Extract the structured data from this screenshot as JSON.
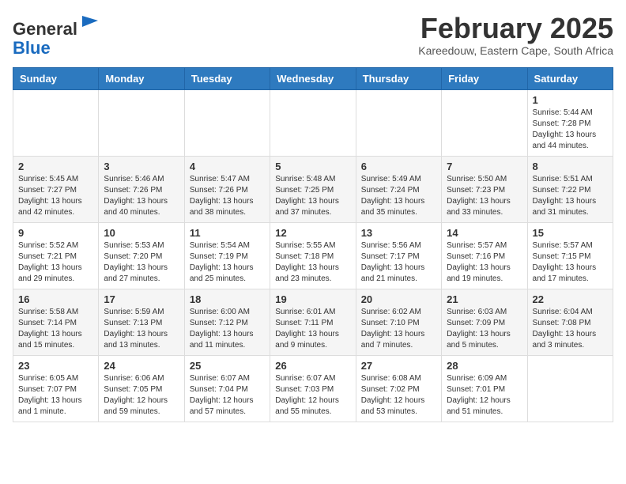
{
  "header": {
    "logo_general": "General",
    "logo_blue": "Blue",
    "month_title": "February 2025",
    "location": "Kareedouw, Eastern Cape, South Africa"
  },
  "weekdays": [
    "Sunday",
    "Monday",
    "Tuesday",
    "Wednesday",
    "Thursday",
    "Friday",
    "Saturday"
  ],
  "weeks": [
    [
      {
        "day": "",
        "info": ""
      },
      {
        "day": "",
        "info": ""
      },
      {
        "day": "",
        "info": ""
      },
      {
        "day": "",
        "info": ""
      },
      {
        "day": "",
        "info": ""
      },
      {
        "day": "",
        "info": ""
      },
      {
        "day": "1",
        "info": "Sunrise: 5:44 AM\nSunset: 7:28 PM\nDaylight: 13 hours\nand 44 minutes."
      }
    ],
    [
      {
        "day": "2",
        "info": "Sunrise: 5:45 AM\nSunset: 7:27 PM\nDaylight: 13 hours\nand 42 minutes."
      },
      {
        "day": "3",
        "info": "Sunrise: 5:46 AM\nSunset: 7:26 PM\nDaylight: 13 hours\nand 40 minutes."
      },
      {
        "day": "4",
        "info": "Sunrise: 5:47 AM\nSunset: 7:26 PM\nDaylight: 13 hours\nand 38 minutes."
      },
      {
        "day": "5",
        "info": "Sunrise: 5:48 AM\nSunset: 7:25 PM\nDaylight: 13 hours\nand 37 minutes."
      },
      {
        "day": "6",
        "info": "Sunrise: 5:49 AM\nSunset: 7:24 PM\nDaylight: 13 hours\nand 35 minutes."
      },
      {
        "day": "7",
        "info": "Sunrise: 5:50 AM\nSunset: 7:23 PM\nDaylight: 13 hours\nand 33 minutes."
      },
      {
        "day": "8",
        "info": "Sunrise: 5:51 AM\nSunset: 7:22 PM\nDaylight: 13 hours\nand 31 minutes."
      }
    ],
    [
      {
        "day": "9",
        "info": "Sunrise: 5:52 AM\nSunset: 7:21 PM\nDaylight: 13 hours\nand 29 minutes."
      },
      {
        "day": "10",
        "info": "Sunrise: 5:53 AM\nSunset: 7:20 PM\nDaylight: 13 hours\nand 27 minutes."
      },
      {
        "day": "11",
        "info": "Sunrise: 5:54 AM\nSunset: 7:19 PM\nDaylight: 13 hours\nand 25 minutes."
      },
      {
        "day": "12",
        "info": "Sunrise: 5:55 AM\nSunset: 7:18 PM\nDaylight: 13 hours\nand 23 minutes."
      },
      {
        "day": "13",
        "info": "Sunrise: 5:56 AM\nSunset: 7:17 PM\nDaylight: 13 hours\nand 21 minutes."
      },
      {
        "day": "14",
        "info": "Sunrise: 5:57 AM\nSunset: 7:16 PM\nDaylight: 13 hours\nand 19 minutes."
      },
      {
        "day": "15",
        "info": "Sunrise: 5:57 AM\nSunset: 7:15 PM\nDaylight: 13 hours\nand 17 minutes."
      }
    ],
    [
      {
        "day": "16",
        "info": "Sunrise: 5:58 AM\nSunset: 7:14 PM\nDaylight: 13 hours\nand 15 minutes."
      },
      {
        "day": "17",
        "info": "Sunrise: 5:59 AM\nSunset: 7:13 PM\nDaylight: 13 hours\nand 13 minutes."
      },
      {
        "day": "18",
        "info": "Sunrise: 6:00 AM\nSunset: 7:12 PM\nDaylight: 13 hours\nand 11 minutes."
      },
      {
        "day": "19",
        "info": "Sunrise: 6:01 AM\nSunset: 7:11 PM\nDaylight: 13 hours\nand 9 minutes."
      },
      {
        "day": "20",
        "info": "Sunrise: 6:02 AM\nSunset: 7:10 PM\nDaylight: 13 hours\nand 7 minutes."
      },
      {
        "day": "21",
        "info": "Sunrise: 6:03 AM\nSunset: 7:09 PM\nDaylight: 13 hours\nand 5 minutes."
      },
      {
        "day": "22",
        "info": "Sunrise: 6:04 AM\nSunset: 7:08 PM\nDaylight: 13 hours\nand 3 minutes."
      }
    ],
    [
      {
        "day": "23",
        "info": "Sunrise: 6:05 AM\nSunset: 7:07 PM\nDaylight: 13 hours\nand 1 minute."
      },
      {
        "day": "24",
        "info": "Sunrise: 6:06 AM\nSunset: 7:05 PM\nDaylight: 12 hours\nand 59 minutes."
      },
      {
        "day": "25",
        "info": "Sunrise: 6:07 AM\nSunset: 7:04 PM\nDaylight: 12 hours\nand 57 minutes."
      },
      {
        "day": "26",
        "info": "Sunrise: 6:07 AM\nSunset: 7:03 PM\nDaylight: 12 hours\nand 55 minutes."
      },
      {
        "day": "27",
        "info": "Sunrise: 6:08 AM\nSunset: 7:02 PM\nDaylight: 12 hours\nand 53 minutes."
      },
      {
        "day": "28",
        "info": "Sunrise: 6:09 AM\nSunset: 7:01 PM\nDaylight: 12 hours\nand 51 minutes."
      },
      {
        "day": "",
        "info": ""
      }
    ]
  ]
}
